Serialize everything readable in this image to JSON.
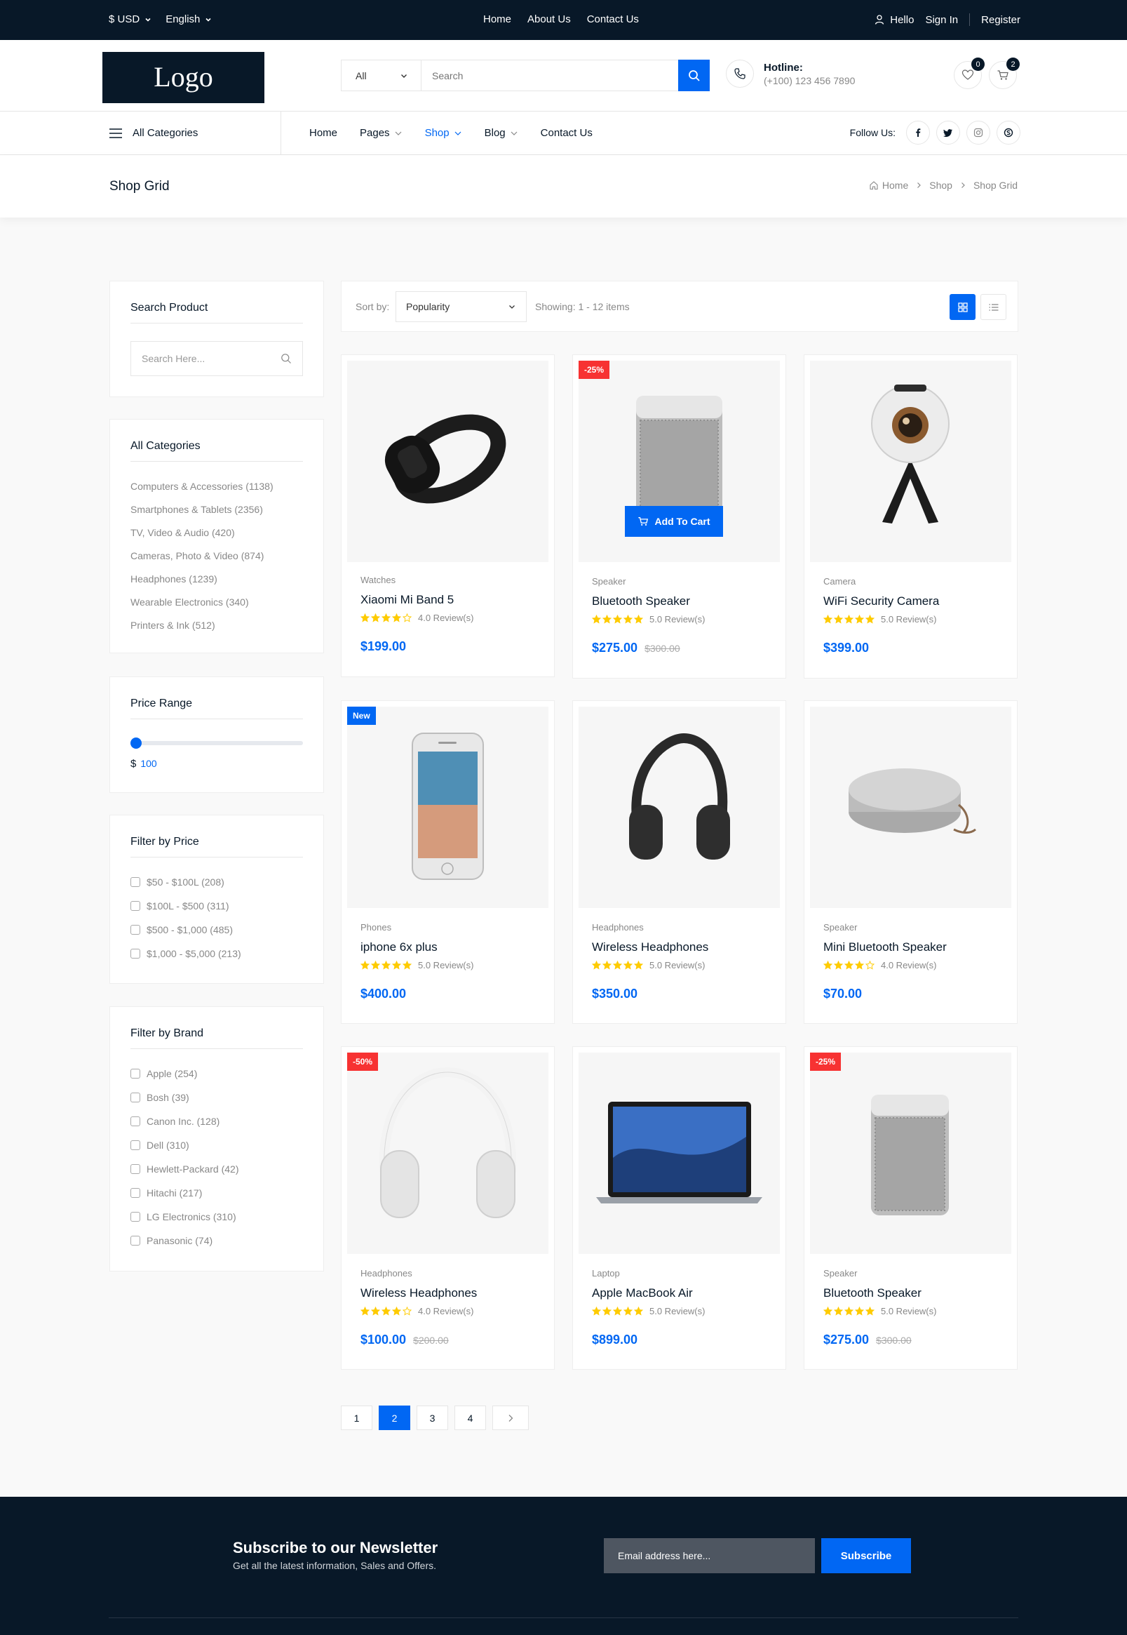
{
  "topbar": {
    "currency": "$ USD",
    "language": "English",
    "links": [
      "Home",
      "About Us",
      "Contact Us"
    ],
    "hello": "Hello",
    "signin": "Sign In",
    "register": "Register"
  },
  "header": {
    "logo": "Logo",
    "search_category": "All",
    "search_placeholder": "Search",
    "hotline_label": "Hotline:",
    "hotline_number": "(+100) 123 456 7890",
    "wishlist_count": "0",
    "cart_count": "2"
  },
  "nav": {
    "all_categories": "All Categories",
    "menu": [
      "Home",
      "Pages",
      "Shop",
      "Blog",
      "Contact Us"
    ],
    "follow_label": "Follow Us:"
  },
  "breadcrumb": {
    "page_title": "Shop Grid",
    "items": [
      "Home",
      "Shop",
      "Shop Grid"
    ]
  },
  "sidebar": {
    "search": {
      "title": "Search Product",
      "placeholder": "Search Here..."
    },
    "categories": {
      "title": "All Categories",
      "items": [
        {
          "name": "Computers & Accessories",
          "count": "(1138)"
        },
        {
          "name": "Smartphones & Tablets",
          "count": "(2356)"
        },
        {
          "name": "TV, Video & Audio",
          "count": "(420)"
        },
        {
          "name": "Cameras, Photo & Video",
          "count": "(874)"
        },
        {
          "name": "Headphones",
          "count": "(1239)"
        },
        {
          "name": "Wearable Electronics",
          "count": "(340)"
        },
        {
          "name": "Printers & Ink",
          "count": "(512)"
        }
      ]
    },
    "price_range": {
      "title": "Price Range",
      "currency": "$",
      "value": "100"
    },
    "filter_price": {
      "title": "Filter by Price",
      "items": [
        "$50 - $100L (208)",
        "$100L - $500 (311)",
        "$500 - $1,000 (485)",
        "$1,000 - $5,000 (213)"
      ]
    },
    "filter_brand": {
      "title": "Filter by Brand",
      "items": [
        "Apple (254)",
        "Bosh (39)",
        "Canon Inc. (128)",
        "Dell (310)",
        "Hewlett-Packard (42)",
        "Hitachi (217)",
        "LG Electronics (310)",
        "Panasonic (74)"
      ]
    }
  },
  "toolbar": {
    "sort_label": "Sort by:",
    "sort_value": "Popularity",
    "showing": "Showing: 1 - 12 items"
  },
  "add_to_cart": "Add To Cart",
  "products": [
    {
      "category": "Watches",
      "name": "Xiaomi Mi Band 5",
      "rating": 4,
      "reviews": "4.0 Review(s)",
      "price": "$199.00",
      "old_price": "",
      "tag": "",
      "image": "fitness-band"
    },
    {
      "category": "Speaker",
      "name": "Bluetooth Speaker",
      "rating": 5,
      "reviews": "5.0 Review(s)",
      "price": "$275.00",
      "old_price": "$300.00",
      "tag": "-25%",
      "image": "speaker"
    },
    {
      "category": "Camera",
      "name": "WiFi Security Camera",
      "rating": 5,
      "reviews": "5.0 Review(s)",
      "price": "$399.00",
      "old_price": "",
      "tag": "",
      "image": "360-camera"
    },
    {
      "category": "Phones",
      "name": "iphone 6x plus",
      "rating": 5,
      "reviews": "5.0 Review(s)",
      "price": "$400.00",
      "old_price": "",
      "tag": "New",
      "image": "phone"
    },
    {
      "category": "Headphones",
      "name": "Wireless Headphones",
      "rating": 5,
      "reviews": "5.0 Review(s)",
      "price": "$350.00",
      "old_price": "",
      "tag": "",
      "image": "black-headphones"
    },
    {
      "category": "Speaker",
      "name": "Mini Bluetooth Speaker",
      "rating": 4,
      "reviews": "4.0 Review(s)",
      "price": "$70.00",
      "old_price": "",
      "tag": "",
      "image": "round-speaker"
    },
    {
      "category": "Headphones",
      "name": "Wireless Headphones",
      "rating": 4,
      "reviews": "4.0 Review(s)",
      "price": "$100.00",
      "old_price": "$200.00",
      "tag": "-50%",
      "image": "white-headphones"
    },
    {
      "category": "Laptop",
      "name": "Apple MacBook Air",
      "rating": 5,
      "reviews": "5.0 Review(s)",
      "price": "$899.00",
      "old_price": "",
      "tag": "",
      "image": "laptop"
    },
    {
      "category": "Speaker",
      "name": "Bluetooth Speaker",
      "rating": 5,
      "reviews": "5.0 Review(s)",
      "price": "$275.00",
      "old_price": "$300.00",
      "tag": "-25%",
      "image": "speaker"
    }
  ],
  "pagination": {
    "pages": [
      "1",
      "2",
      "3",
      "4"
    ],
    "active": "2"
  },
  "newsletter": {
    "title": "Subscribe to our Newsletter",
    "subtitle": "Get all the latest information, Sales and Offers.",
    "placeholder": "Email address here...",
    "button": "Subscribe"
  },
  "colors": {
    "primary": "#0167f3",
    "dark": "#081828",
    "sale": "#f73232",
    "star": "#fecb00"
  }
}
